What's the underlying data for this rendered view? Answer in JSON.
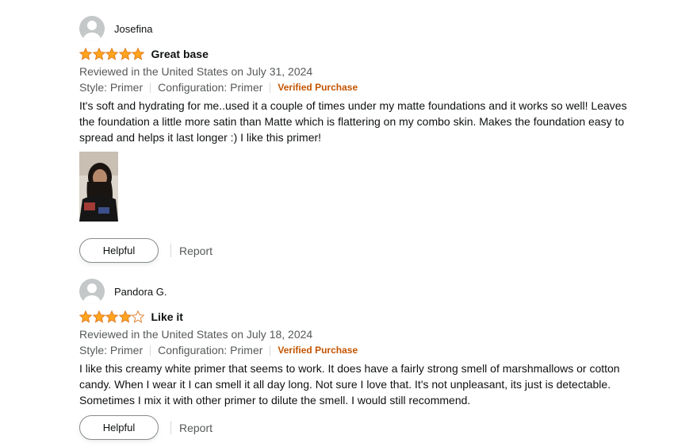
{
  "colors": {
    "star": "#FFA41C",
    "verified": "#C45500",
    "secondary_text": "#565959",
    "button_border": "#888C8C"
  },
  "reviews": [
    {
      "reviewer": "Josefina",
      "rating": 5,
      "title": "Great base",
      "date": "Reviewed in the United States on July 31, 2024",
      "style": "Style: Primer",
      "configuration": "Configuration: Primer",
      "verified": "Verified Purchase",
      "body": "It's soft and hydrating for me..used it a couple of times under my matte foundations and it works so well! Leaves the foundation a little more satin than Matte which is flattering on my combo skin. Makes the foundation easy to spread and helps it last longer :) I like this primer!",
      "has_photo": true,
      "helpful_label": "Helpful",
      "report_label": "Report"
    },
    {
      "reviewer": "Pandora G.",
      "rating": 4,
      "title": "Like it",
      "date": "Reviewed in the United States on July 18, 2024",
      "style": "Style: Primer",
      "configuration": "Configuration: Primer",
      "verified": "Verified Purchase",
      "body": "I like this creamy white primer that seems to work. It does have a fairly strong smell of marshmallows or cotton candy. When I wear it I can smell it all day long. Not sure I love that. It's not unpleasant, its just is detectable. Sometimes I mix it with other primer to dilute the smell. I would still recommend.",
      "has_photo": false,
      "helpful_label": "Helpful",
      "report_label": "Report"
    }
  ]
}
